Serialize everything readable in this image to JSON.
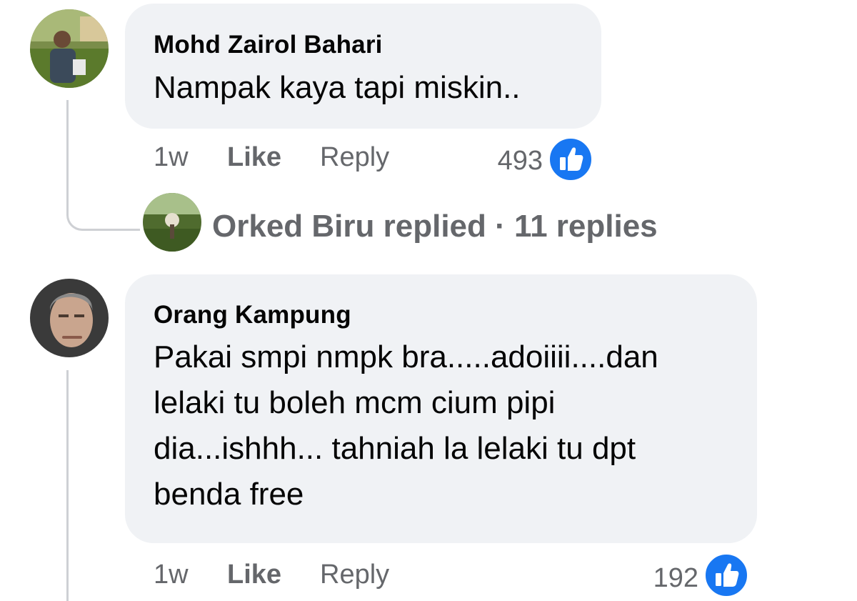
{
  "comments": [
    {
      "author": "Mohd Zairol Bahari",
      "text": "Nampak kaya tapi miskin..",
      "time": "1w",
      "like_label": "Like",
      "reply_label": "Reply",
      "reaction_count": "493"
    },
    {
      "author": "Orang Kampung",
      "text_lines": [
        "Pakai smpi nmpk bra.....adoiiii....dan",
        "lelaki tu boleh mcm cium pipi",
        "dia...ishhh... tahniah la lelaki tu dpt",
        "benda free"
      ],
      "time": "1w",
      "like_label": "Like",
      "reply_label": "Reply",
      "reaction_count": "192"
    }
  ],
  "replies_summary": {
    "name": "Orked Biru",
    "action": "replied",
    "separator": "·",
    "count_text": "11 replies"
  },
  "colors": {
    "bubble": "#f0f2f5",
    "meta_text": "#65676b",
    "like_blue": "#1877f2",
    "thread_line": "#ced0d4"
  },
  "icons": [
    "thumbs-up-icon"
  ]
}
